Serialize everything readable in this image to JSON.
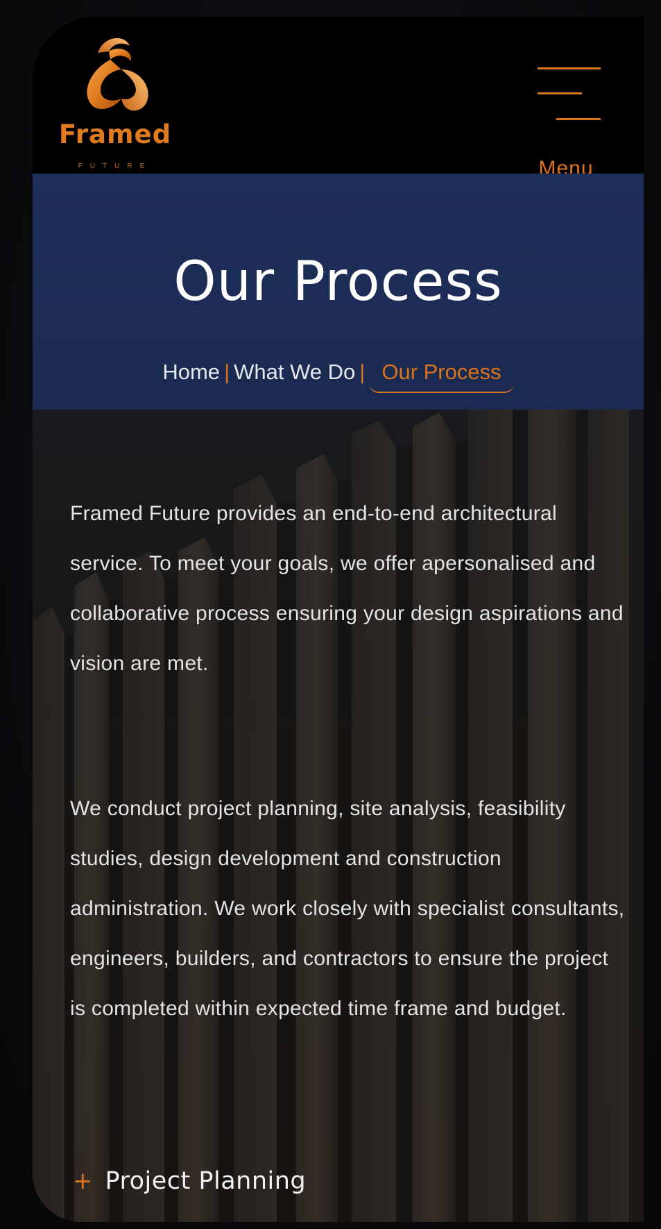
{
  "header": {
    "logo_text": "Framed",
    "logo_subtext": "FUTURE",
    "menu_label": "Menu"
  },
  "hero": {
    "title": "Our Process",
    "breadcrumb": {
      "home": "Home",
      "what_we_do": "What We Do",
      "current": "Our Process",
      "separator": "|"
    }
  },
  "content": {
    "paragraph_1": "Framed Future provides an end-to-end architectural service. To meet your goals, we offer apersonalised and collaborative process ensuring your design aspirations and vision are met.",
    "paragraph_2": "We conduct project planning, site analysis, feasibility studies, design development and construction administration. We work closely with specialist consultants, engineers, builders, and contractors to ensure the project is completed within expected time frame and budget.",
    "accordion_items": [
      {
        "icon": "plus-icon",
        "label": "Project Planning"
      }
    ]
  },
  "colors": {
    "accent": "#d9731d",
    "hero_bg": "#1e2f5a",
    "header_bg": "#000000",
    "text": "#e4e4e6"
  }
}
